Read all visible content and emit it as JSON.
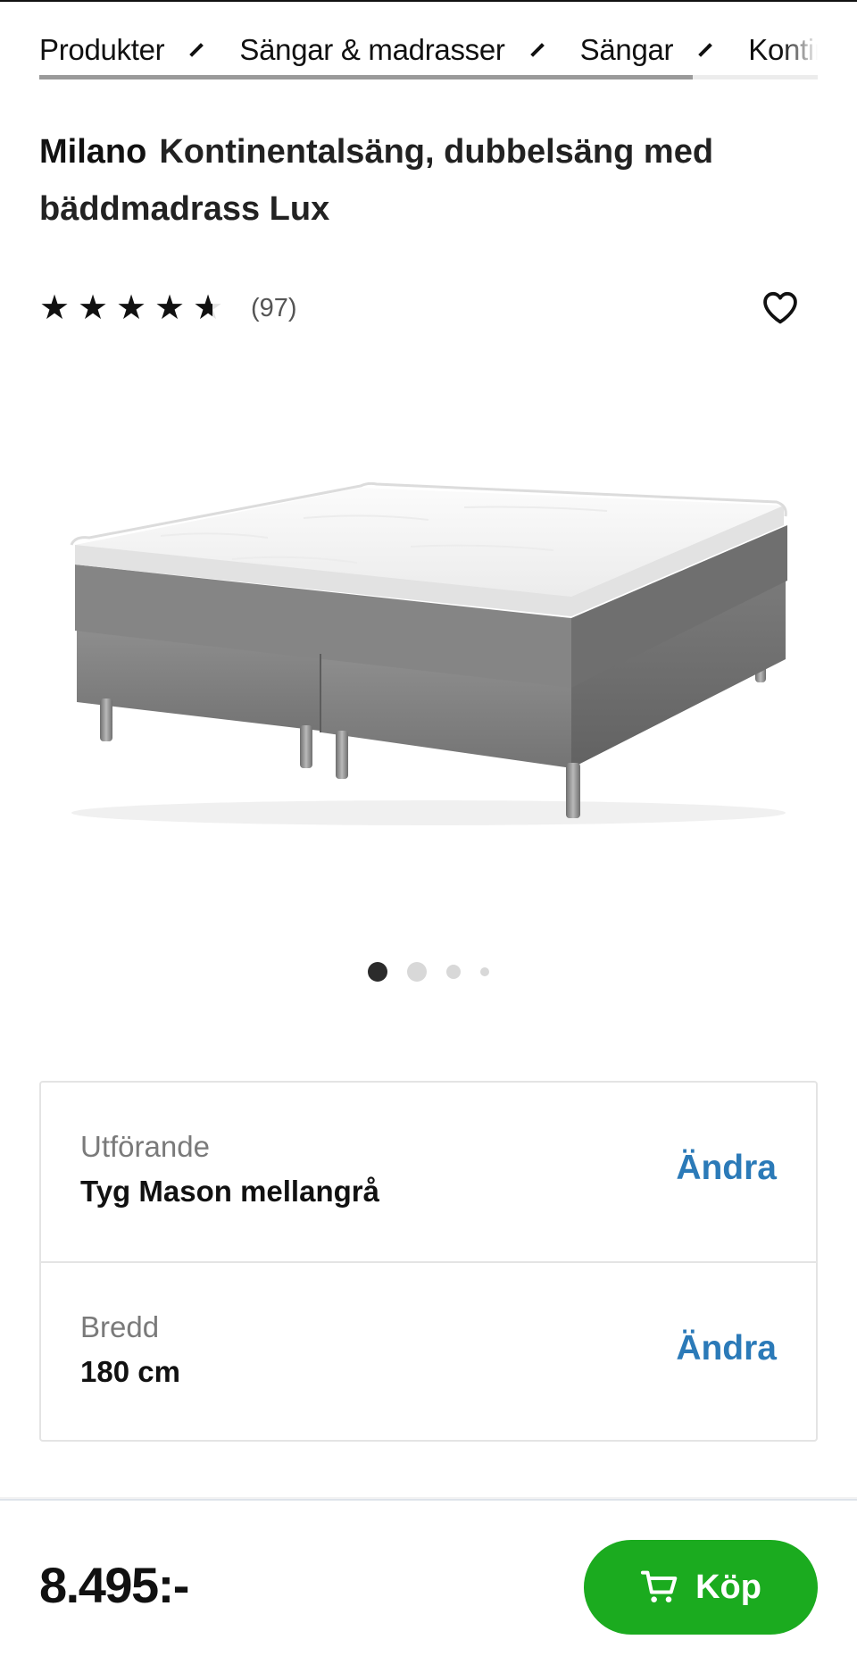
{
  "breadcrumb": {
    "items": [
      "Produkter",
      "Sängar & madrasser",
      "Sängar",
      "Kontinentalsängar"
    ],
    "scroll_progress": 0.84
  },
  "product": {
    "brand": "Milano",
    "title": "Kontinentalsäng, dubbelsäng med bäddmadrass Lux",
    "rating": 4.5,
    "rating_max": 5,
    "review_count": "(97)",
    "image_icon": "bed-product-photo"
  },
  "carousel": {
    "count": 4,
    "active_index": 0
  },
  "options": [
    {
      "label": "Utförande",
      "value": "Tyg Mason mellangrå",
      "action": "Ändra"
    },
    {
      "label": "Bredd",
      "value": "180 cm",
      "action": "Ändra"
    }
  ],
  "footer": {
    "price": "8.495:-",
    "buy_label": "Köp",
    "buy_icon": "cart-icon",
    "buy_color": "#1bab1f"
  },
  "colors": {
    "link": "#2b7ab8",
    "text": "#111111",
    "muted": "#7a7a7a"
  }
}
